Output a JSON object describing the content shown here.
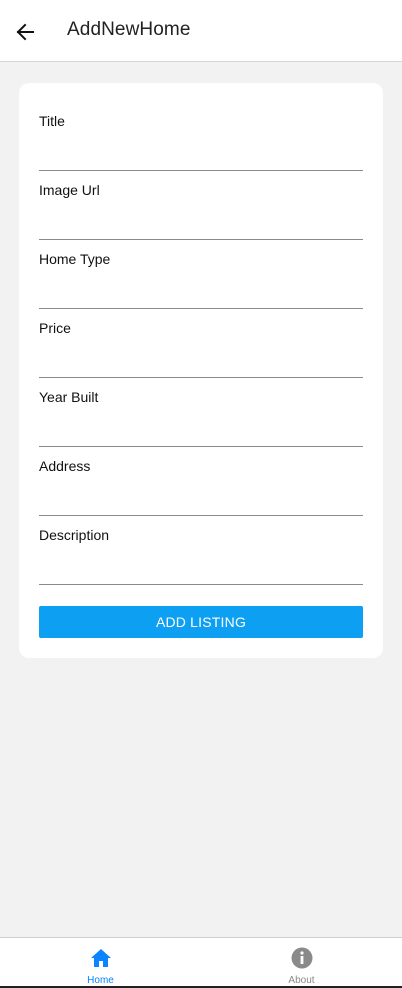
{
  "appbar": {
    "title": "AddNewHome",
    "back_icon": "arrow-left-icon"
  },
  "form": {
    "fields": [
      {
        "label": "Title",
        "value": "",
        "placeholder": ""
      },
      {
        "label": "Image Url",
        "value": "",
        "placeholder": ""
      },
      {
        "label": "Home Type",
        "value": "",
        "placeholder": ""
      },
      {
        "label": "Price",
        "value": "",
        "placeholder": ""
      },
      {
        "label": "Year Built",
        "value": "",
        "placeholder": ""
      },
      {
        "label": "Address",
        "value": "",
        "placeholder": ""
      },
      {
        "label": "Description",
        "value": "",
        "placeholder": ""
      }
    ],
    "submit_label": "ADD LISTING"
  },
  "bottom_nav": {
    "items": [
      {
        "label": "Home",
        "icon": "home-icon",
        "active": true
      },
      {
        "label": "About",
        "icon": "info-icon",
        "active": false
      }
    ]
  },
  "colors": {
    "accent": "#0c9ff2",
    "nav_active": "#0a84ff",
    "nav_inactive": "#8a8a8a",
    "background": "#f2f2f2"
  }
}
